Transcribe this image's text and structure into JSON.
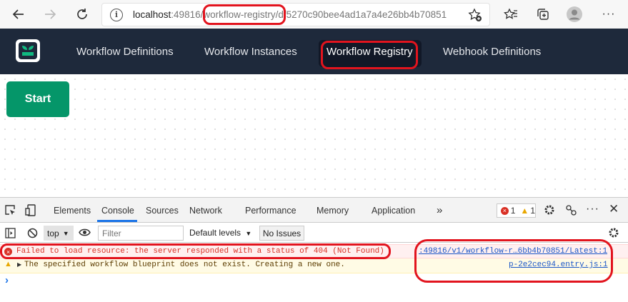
{
  "browser": {
    "url_host": "localhost",
    "url_port": ":49816",
    "url_path_highlight": "/workflow-registry",
    "url_path_rest": "/df5270c90bee4ad1a7a4e26bb4b70851"
  },
  "app": {
    "nav": [
      "Workflow Definitions",
      "Workflow Instances",
      "Workflow Registry",
      "Webhook Definitions"
    ],
    "active_nav": "Workflow Registry",
    "start_label": "Start",
    "colors": {
      "nav_bg": "#1e293b",
      "start_btn": "#059669",
      "highlight": "#e2141e"
    }
  },
  "devtools": {
    "tabs": [
      "Elements",
      "Console",
      "Sources",
      "Network",
      "Performance",
      "Memory",
      "Application"
    ],
    "active_tab": "Console",
    "more": "»",
    "error_count": "1",
    "warn_count": "1",
    "context": "top",
    "filter_placeholder": "Filter",
    "levels": "Default levels",
    "issues": "No Issues",
    "messages": [
      {
        "level": "error",
        "text": "Failed to load resource: the server responded with a status of 404 (Not Found)",
        "source": ":49816/v1/workflow-r…6bb4b70851/Latest:1"
      },
      {
        "level": "warning",
        "text": "The specified workflow blueprint does not exist. Creating a new one.",
        "source": "p-2e2cec94.entry.js:1"
      }
    ],
    "prompt": "›"
  }
}
